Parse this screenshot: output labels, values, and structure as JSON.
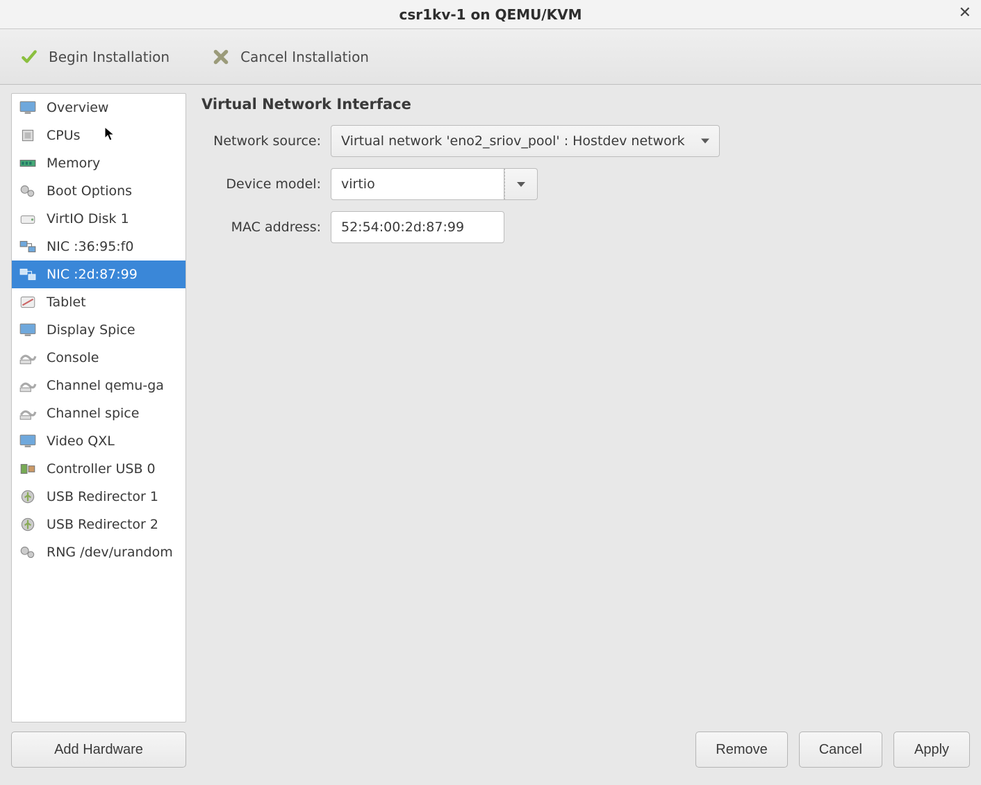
{
  "window": {
    "title": "csr1kv-1 on QEMU/KVM"
  },
  "toolbar": {
    "begin_label": "Begin Installation",
    "cancel_label": "Cancel Installation"
  },
  "sidebar": {
    "items": [
      {
        "label": "Overview",
        "icon": "monitor-icon"
      },
      {
        "label": "CPUs",
        "icon": "cpu-icon"
      },
      {
        "label": "Memory",
        "icon": "memory-icon"
      },
      {
        "label": "Boot Options",
        "icon": "gears-icon"
      },
      {
        "label": "VirtIO Disk 1",
        "icon": "disk-icon"
      },
      {
        "label": "NIC :36:95:f0",
        "icon": "nic-icon"
      },
      {
        "label": "NIC :2d:87:99",
        "icon": "nic-icon"
      },
      {
        "label": "Tablet",
        "icon": "tablet-icon"
      },
      {
        "label": "Display Spice",
        "icon": "monitor-icon"
      },
      {
        "label": "Console",
        "icon": "serial-icon"
      },
      {
        "label": "Channel qemu-ga",
        "icon": "serial-icon"
      },
      {
        "label": "Channel spice",
        "icon": "serial-icon"
      },
      {
        "label": "Video QXL",
        "icon": "monitor-icon"
      },
      {
        "label": "Controller USB 0",
        "icon": "controller-icon"
      },
      {
        "label": "USB Redirector 1",
        "icon": "usb-icon"
      },
      {
        "label": "USB Redirector 2",
        "icon": "usb-icon"
      },
      {
        "label": "RNG /dev/urandom",
        "icon": "gears-icon"
      }
    ],
    "selected_index": 6,
    "add_hardware_label": "Add Hardware"
  },
  "detail": {
    "heading": "Virtual Network Interface",
    "network_source_label": "Network source:",
    "network_source_value": "Virtual network 'eno2_sriov_pool' : Hostdev network",
    "device_model_label": "Device model:",
    "device_model_value": "virtio",
    "mac_label": "MAC address:",
    "mac_value": "52:54:00:2d:87:99"
  },
  "footer": {
    "remove_label": "Remove",
    "cancel_label": "Cancel",
    "apply_label": "Apply"
  }
}
